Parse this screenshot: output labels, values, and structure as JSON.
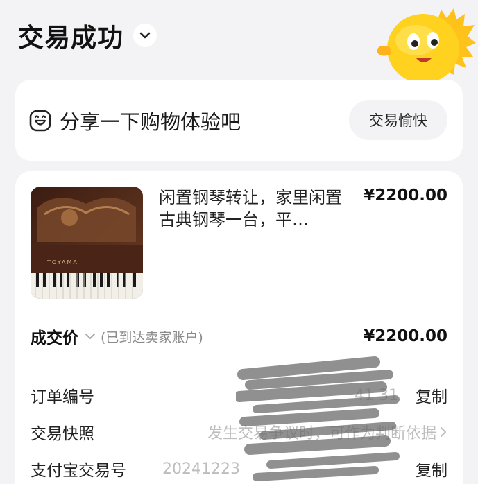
{
  "header": {
    "title": "交易成功"
  },
  "share": {
    "text": "分享一下购物体验吧",
    "button_label": "交易愉快"
  },
  "item": {
    "title": "闲置钢琴转让，家里闲置古典钢琴一台，平…",
    "price": "¥2200.00",
    "thumb_brand": "TOYAMA"
  },
  "deal": {
    "label": "成交价",
    "note": "(已到达卖家账户)",
    "price": "¥2200.00"
  },
  "rows": {
    "order_no": {
      "label": "订单编号",
      "value": "41                         31",
      "action": "复制"
    },
    "snapshot": {
      "label": "交易快照",
      "value": "发生交易争议时，可作为判断依据"
    },
    "alipay_no": {
      "label": "支付宝交易号",
      "value": "20241223",
      "action": "复制"
    }
  },
  "colors": {
    "background": "#f3f3f5",
    "card": "#ffffff",
    "muted": "#bdbdbd",
    "mascot": "#ffd21f"
  }
}
